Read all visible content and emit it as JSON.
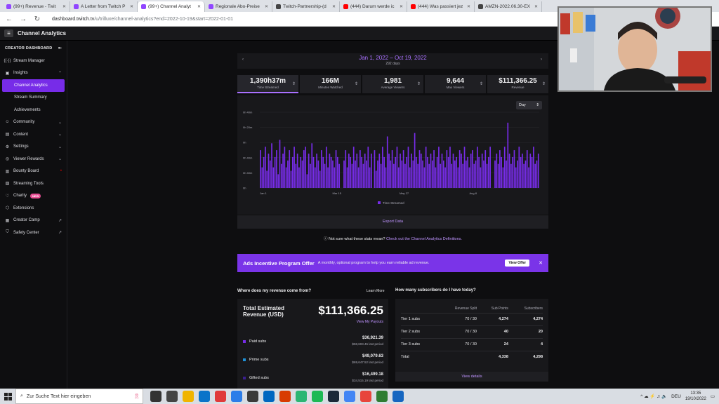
{
  "browser": {
    "tabs": [
      {
        "title": "(99+) Revenue - Twit",
        "color": "#9146ff"
      },
      {
        "title": "A Letter from Twitch P",
        "color": "#9146ff"
      },
      {
        "title": "(99+) Channel Analyt",
        "color": "#9146ff"
      },
      {
        "title": "Regionale Abo-Preise",
        "color": "#9146ff"
      },
      {
        "title": "Twitch-Partnership-(d",
        "color": "#444444"
      },
      {
        "title": "(444) Darum werde ic",
        "color": "#ff0000"
      },
      {
        "title": "(444) Was passiert jez",
        "color": "#ff0000"
      },
      {
        "title": "AMZN-2022.06.30-EX",
        "color": "#444444"
      }
    ],
    "url_host": "dashboard.twitch.tv",
    "url_path": "/u/trilluxe/channel-analytics?end=2022-10-19&start=2022-01-01"
  },
  "header": {
    "title": "Channel Analytics"
  },
  "sidebar": {
    "heading": "CREATOR DASHBOARD",
    "items": [
      {
        "label": "Stream Manager",
        "icon": "signal-icon",
        "right": ""
      },
      {
        "label": "Insights",
        "icon": "insights-icon",
        "right": "^"
      },
      {
        "label": "Channel Analytics",
        "icon": "",
        "right": ""
      },
      {
        "label": "Stream Summary",
        "icon": "",
        "right": ""
      },
      {
        "label": "Achievements",
        "icon": "",
        "right": ""
      },
      {
        "label": "Community",
        "icon": "community-icon",
        "right": "v"
      },
      {
        "label": "Content",
        "icon": "content-icon",
        "right": "v"
      },
      {
        "label": "Settings",
        "icon": "gear-icon",
        "right": "v"
      },
      {
        "label": "Viewer Rewards",
        "icon": "rewards-icon",
        "right": "v"
      },
      {
        "label": "Bounty Board",
        "icon": "bounty-icon",
        "right": "•"
      },
      {
        "label": "Streaming Tools",
        "icon": "tools-icon",
        "right": ""
      },
      {
        "label": "Charity",
        "icon": "heart-icon",
        "badge": "NEW"
      },
      {
        "label": "Extensions",
        "icon": "extensions-icon",
        "right": ""
      },
      {
        "label": "Creator Camp",
        "icon": "camp-icon",
        "right": "↗"
      },
      {
        "label": "Safety Center",
        "icon": "shield-icon",
        "right": "↗"
      }
    ]
  },
  "date_range": {
    "label": "Jan 1, 2022 – Oct 19, 2022",
    "days": "292 days"
  },
  "stats": [
    {
      "value": "1,390h37m",
      "label": "Time Streamed",
      "active": true
    },
    {
      "value": "166M",
      "label": "Minutes Watched"
    },
    {
      "value": "1,981",
      "label": "Average Viewers"
    },
    {
      "value": "9,644",
      "label": "Max Viewers"
    },
    {
      "value": "$111,366.25",
      "label": "Revenue"
    }
  ],
  "chart_controls": {
    "granularity": "Day"
  },
  "chart_data": {
    "type": "bar",
    "title": "",
    "xlabel": "",
    "ylabel": "",
    "y_ticks": [
      "0h 40m",
      "0h 20m",
      "0h",
      "0h 40m",
      "0h 40m",
      "0h"
    ],
    "x_ticks": [
      "Jan 1",
      "Mar 15",
      "May 27",
      "Aug 8"
    ],
    "legend": "Time Streamed",
    "bar_color": "#772ce8",
    "values": [
      0.55,
      0.3,
      0.45,
      0.6,
      0.25,
      0.5,
      0.4,
      0.65,
      0.3,
      0.45,
      0.55,
      0.2,
      0.7,
      0.35,
      0.5,
      0.6,
      0.3,
      0.4,
      0.55,
      0.25,
      0.45,
      0.6,
      0.35,
      0.5,
      0.3,
      0.45,
      0.4,
      0.55,
      0.6,
      0.2,
      0.5,
      0.35,
      0.65,
      0.45,
      0.3,
      0.5,
      0.4,
      0.25,
      0.55,
      0.45,
      0.35,
      0.6,
      0.3,
      0.5,
      0.45,
      0.4,
      0.3,
      0.55,
      0.45,
      0.35,
      0,
      0,
      0.4,
      0.55,
      0.3,
      0.5,
      0.45,
      0.35,
      0.6,
      0.4,
      0.5,
      0.3,
      0.55,
      0.45,
      0.35,
      0.5,
      0.4,
      0.6,
      0.3,
      0.5,
      0,
      0.55,
      0.25,
      0.4,
      0.5,
      0.35,
      0.6,
      0.45,
      0.3,
      0.75,
      0.5,
      0.4,
      0.55,
      0.35,
      0.45,
      0.6,
      0.3,
      0.5,
      0.4,
      0.55,
      0.35,
      0.45,
      0.6,
      0.3,
      0.5,
      0.4,
      0.8,
      0.45,
      0.35,
      0.55,
      0.5,
      0.4,
      0.3,
      0.6,
      0.45,
      0.35,
      0.5,
      0.4,
      0.55,
      0.3,
      0.45,
      0.6,
      0.35,
      0.5,
      0.4,
      0.3,
      0.55,
      0.45,
      0.6,
      0.35,
      0.5,
      0.4,
      0.45,
      0.3,
      0.55,
      0.5,
      0.35,
      0.6,
      0.4,
      0.45,
      0.3,
      0.5,
      0.55,
      0.35,
      0.4,
      0.6,
      0.45,
      0.3,
      0.5,
      0.4,
      0.55,
      0.35,
      0.45,
      0.6,
      0,
      0,
      0.4,
      0.5,
      0.35,
      0.55,
      0.45,
      0.3,
      0.6,
      0.4,
      0.95,
      0.5,
      0.35,
      0.45,
      0.55,
      0.3,
      0.4,
      0.6,
      0.45,
      0.5,
      0.35,
      0.4,
      0.55,
      0.3,
      0.5,
      0.45,
      0.6,
      0.35,
      0.4,
      0.5
    ]
  },
  "export_label": "Export Data",
  "help": {
    "text": "Not sure what these stats mean?",
    "link": "Check out the Channel Analytics Definitions."
  },
  "promo": {
    "title": "Ads Incentive Program Offer",
    "desc": "A monthly, optional program to help you earn reliable ad revenue.",
    "button": "View Offer"
  },
  "revenue": {
    "question": "Where does my revenue come from?",
    "learn_more": "Learn More",
    "total_label": "Total Estimated Revenue (USD)",
    "total_value": "$111,366.25",
    "view_payouts": "View My Payouts",
    "rows": [
      {
        "name": "Paid subs",
        "amount": "$36,921.39",
        "prev": "$58,603.45 last period",
        "color": "#772ce8"
      },
      {
        "name": "Prime subs",
        "amount": "$49,079.63",
        "prev": "$69,647.52 last period",
        "color": "#1e90d6"
      },
      {
        "name": "Gifted subs",
        "amount": "$16,499.18",
        "prev": "$34,515.19 last period",
        "color": "#3a1f8f"
      }
    ]
  },
  "subscribers": {
    "question": "How many subscribers do I have today?",
    "headers": [
      "",
      "Revenue Split",
      "Sub Points",
      "Subscribers"
    ],
    "rows": [
      [
        "Tier 1 subs",
        "70 / 30",
        "4,274",
        "4,274"
      ],
      [
        "Tier 2 subs",
        "70 / 30",
        "40",
        "20"
      ],
      [
        "Tier 3 subs",
        "70 / 30",
        "24",
        "4"
      ],
      [
        "Total",
        "",
        "4,338",
        "4,298"
      ]
    ],
    "view_details": "View details"
  },
  "taskbar": {
    "search_placeholder": "Zur Suche Text hier eingeben",
    "lang": "DEU",
    "time": "13:35",
    "date": "19/10/2022"
  }
}
